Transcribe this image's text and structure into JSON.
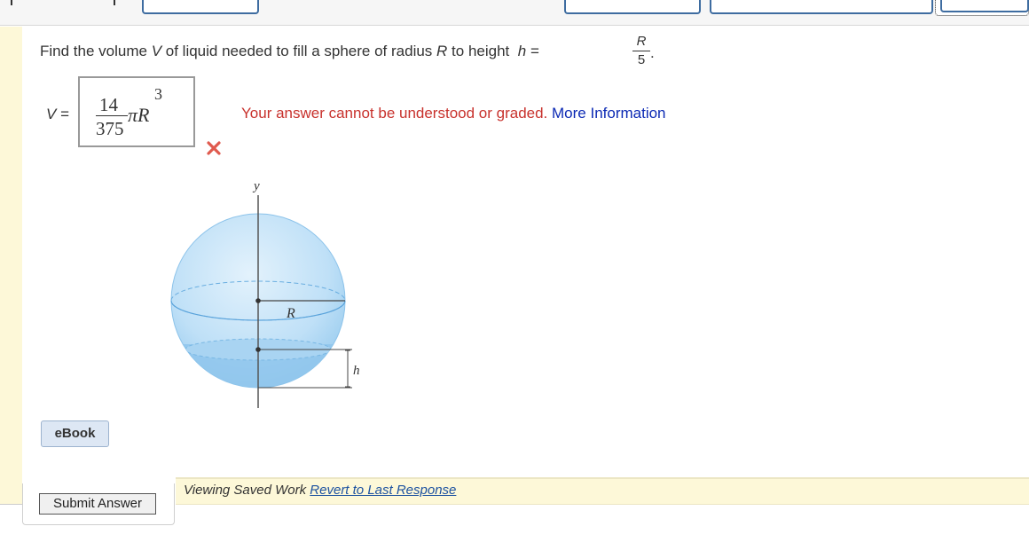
{
  "question": {
    "prefix": "Find the volume",
    "var_v": "V",
    "middle": "of liquid needed to fill a sphere of radius",
    "var_r": "R",
    "to_height": "to height",
    "var_h": "h",
    "equals": "=",
    "frac_num": "R",
    "frac_den": "5",
    "period": "."
  },
  "answer": {
    "label_var": "V",
    "label_eq": "=",
    "numerator": "14",
    "denominator": "375",
    "symbol": "πR",
    "exponent": "3"
  },
  "feedback": {
    "error_text": "Your answer cannot be understood or graded.",
    "more_info": "More Information",
    "error_color": "#c8322d",
    "link_color": "#0c2ab4"
  },
  "figure": {
    "axis_label_y": "y",
    "radius_label": "R",
    "height_label": "h",
    "sphere_color": "#bfe0f7",
    "liquid_color": "#8fc6ec"
  },
  "buttons": {
    "ebook": "eBook",
    "submit": "Submit Answer"
  },
  "saved": {
    "text": "Viewing Saved Work",
    "revert": "Revert to Last Response"
  }
}
